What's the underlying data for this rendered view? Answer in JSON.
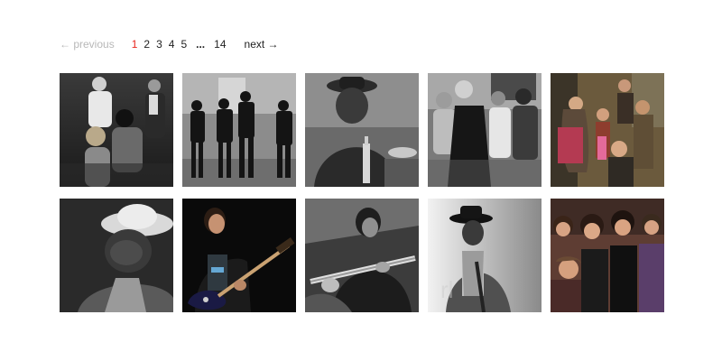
{
  "pagination": {
    "previous_label": "← previous",
    "next_label": "next →",
    "pages": [
      "1",
      "2",
      "3",
      "4",
      "5"
    ],
    "ellipsis": "...",
    "last_page": "14",
    "current_page": "1",
    "current_color": "#e8261e",
    "disabled_color": "#b8b8b8"
  },
  "photos": [
    {
      "subject": "group-portrait-four-people",
      "tone": "grayscale"
    },
    {
      "subject": "band-four-men-standing-street",
      "tone": "grayscale"
    },
    {
      "subject": "man-in-hat-at-table-with-bottle",
      "tone": "grayscale"
    },
    {
      "subject": "young-men-group-street",
      "tone": "grayscale"
    },
    {
      "subject": "band-five-people-color",
      "tone": "color"
    },
    {
      "subject": "man-in-straw-hat-closeup",
      "tone": "grayscale"
    },
    {
      "subject": "guitarist-playing-electric-guitar",
      "tone": "color"
    },
    {
      "subject": "guitarist-playing-closeup",
      "tone": "grayscale"
    },
    {
      "subject": "musician-in-hat-with-guitar",
      "tone": "grayscale"
    },
    {
      "subject": "band-five-men-color",
      "tone": "color"
    }
  ]
}
